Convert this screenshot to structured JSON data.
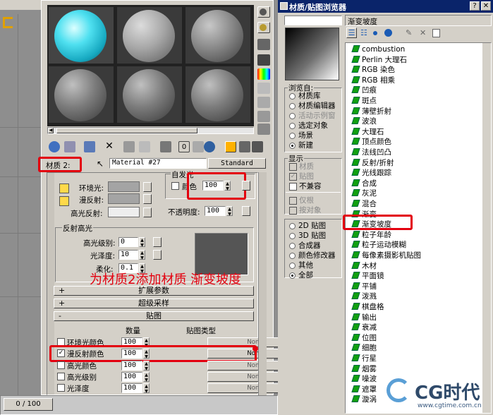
{
  "timeline": {
    "counter": "0 / 100"
  },
  "material_editor": {
    "material_slot_label": "材质 2:",
    "material_name": "Material #27",
    "material_type_button": "Standard",
    "basic": {
      "ambient_label": "环境光:",
      "diffuse_label": "漫反射:",
      "specular_label": "高光反射:",
      "self_illum_group": "自发光",
      "color_label": "颜色",
      "color_value": "100",
      "opacity_label": "不透明度:",
      "opacity_value": "100"
    },
    "specular_highlights": {
      "group": "反射高光",
      "level_label": "高光级别:",
      "level_value": "0",
      "gloss_label": "光泽度:",
      "gloss_value": "10",
      "soften_label": "柔化:",
      "soften_value": "0.1"
    },
    "rollouts": {
      "extended": "扩展参数",
      "supersampling": "超级采样",
      "maps": "贴图"
    },
    "maps_header": {
      "amount": "数量",
      "map_type": "贴图类型"
    },
    "maps": [
      {
        "label": "环境光颜色",
        "amount": "100",
        "map": "None",
        "checked": false
      },
      {
        "label": "漫反射颜色",
        "amount": "100",
        "map": "None",
        "checked": true
      },
      {
        "label": "高光颜色",
        "amount": "100",
        "map": "None",
        "checked": false
      },
      {
        "label": "高光级别",
        "amount": "100",
        "map": "None",
        "checked": false
      },
      {
        "label": "光泽度",
        "amount": "100",
        "map": "None",
        "checked": false
      }
    ],
    "annotation": "为材质2添加材质 渐变坡度"
  },
  "browser": {
    "title": "材质/贴图浏览器",
    "selected_name": "渐变坡度",
    "browse_from": {
      "group": "浏览自:",
      "options": [
        "材质库",
        "材质编辑器",
        "活动示例窗",
        "选定对象",
        "场景",
        "新建"
      ],
      "selected": 5
    },
    "show": {
      "group": "显示",
      "options": [
        "材质",
        "贴图",
        "不兼容",
        "仅根",
        "按对象"
      ]
    },
    "map_filter": {
      "options": [
        "2D 贴图",
        "3D 贴图",
        "合成器",
        "颜色修改器",
        "其他",
        "全部"
      ],
      "selected": 5
    },
    "map_list": [
      "combustion",
      "Perlin 大理石",
      "RGB 染色",
      "RGB 相乘",
      "凹痕",
      "斑点",
      "薄壁折射",
      "波浪",
      "大理石",
      "顶点颜色",
      "法线凹凸",
      "反射/折射",
      "光线跟踪",
      "合成",
      "灰泥",
      "混合",
      "渐变",
      "渐变坡度",
      "粒子年龄",
      "粒子运动模糊",
      "每像素摄影机贴图",
      "木材",
      "平面镜",
      "平铺",
      "泼溅",
      "棋盘格",
      "输出",
      "衰减",
      "位图",
      "细胞",
      "行星",
      "烟雾",
      "噪波",
      "遮罩",
      "漩涡"
    ],
    "highlighted_item": "渐变坡度"
  },
  "watermark": {
    "brand": "CG时代",
    "url": "www.cgtime.com.cn"
  }
}
